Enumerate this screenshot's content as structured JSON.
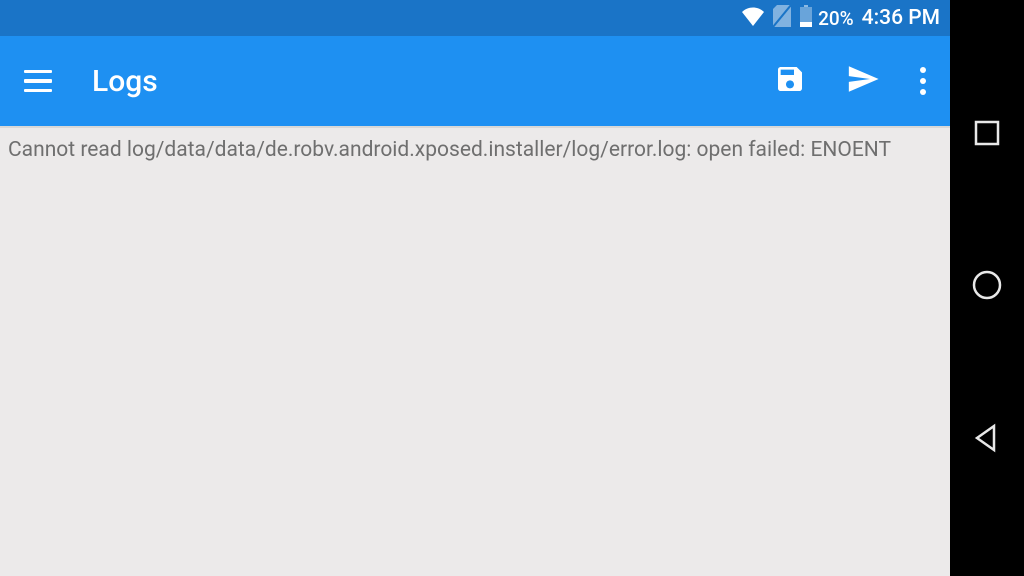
{
  "status": {
    "battery_percent": "20%",
    "time": "4:36 PM"
  },
  "appbar": {
    "title": "Logs"
  },
  "content": {
    "log_message": "Cannot read log/data/data/de.robv.android.xposed.installer/log/error.log: open failed: ENOENT"
  }
}
